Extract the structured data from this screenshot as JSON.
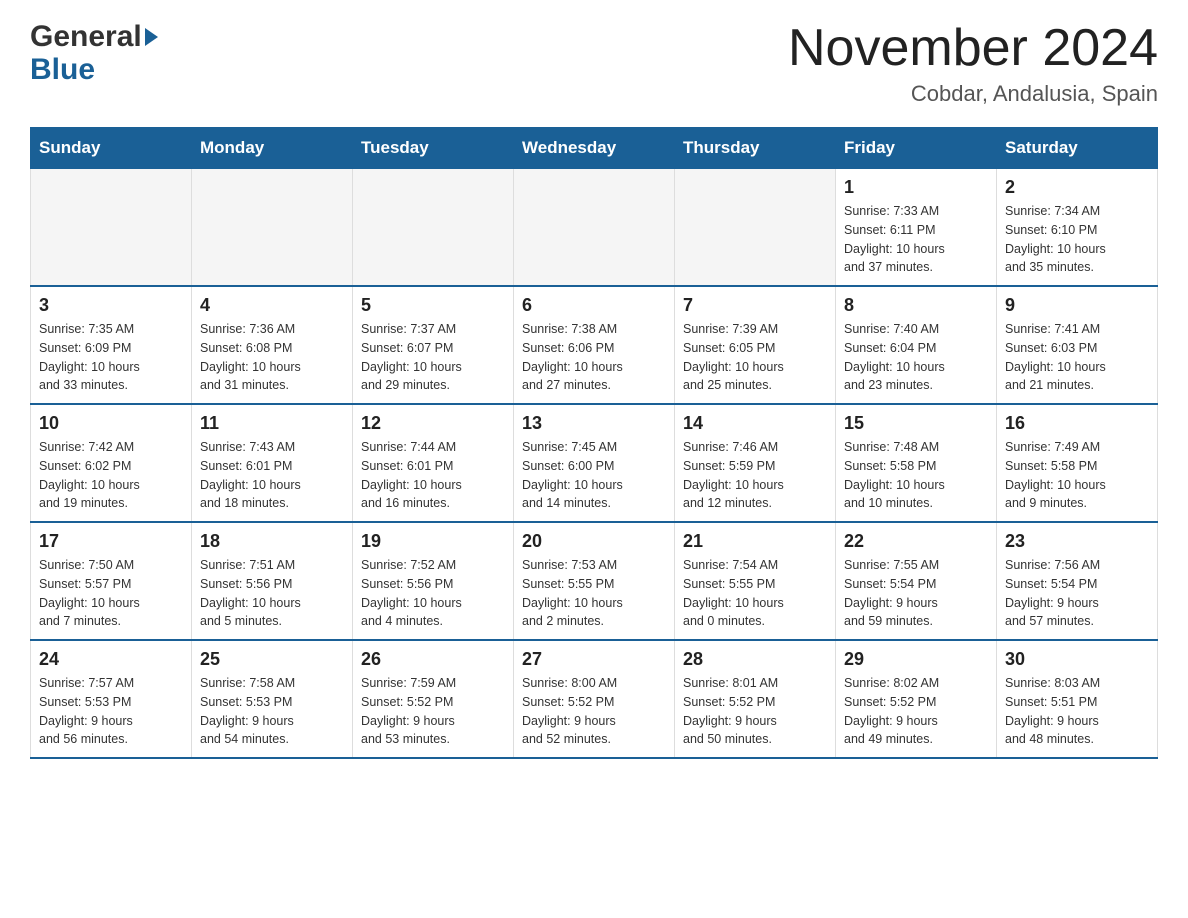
{
  "header": {
    "month_year": "November 2024",
    "location": "Cobdar, Andalusia, Spain",
    "logo_general": "General",
    "logo_blue": "Blue"
  },
  "weekdays": [
    "Sunday",
    "Monday",
    "Tuesday",
    "Wednesday",
    "Thursday",
    "Friday",
    "Saturday"
  ],
  "weeks": [
    [
      {
        "day": "",
        "info": ""
      },
      {
        "day": "",
        "info": ""
      },
      {
        "day": "",
        "info": ""
      },
      {
        "day": "",
        "info": ""
      },
      {
        "day": "",
        "info": ""
      },
      {
        "day": "1",
        "info": "Sunrise: 7:33 AM\nSunset: 6:11 PM\nDaylight: 10 hours\nand 37 minutes."
      },
      {
        "day": "2",
        "info": "Sunrise: 7:34 AM\nSunset: 6:10 PM\nDaylight: 10 hours\nand 35 minutes."
      }
    ],
    [
      {
        "day": "3",
        "info": "Sunrise: 7:35 AM\nSunset: 6:09 PM\nDaylight: 10 hours\nand 33 minutes."
      },
      {
        "day": "4",
        "info": "Sunrise: 7:36 AM\nSunset: 6:08 PM\nDaylight: 10 hours\nand 31 minutes."
      },
      {
        "day": "5",
        "info": "Sunrise: 7:37 AM\nSunset: 6:07 PM\nDaylight: 10 hours\nand 29 minutes."
      },
      {
        "day": "6",
        "info": "Sunrise: 7:38 AM\nSunset: 6:06 PM\nDaylight: 10 hours\nand 27 minutes."
      },
      {
        "day": "7",
        "info": "Sunrise: 7:39 AM\nSunset: 6:05 PM\nDaylight: 10 hours\nand 25 minutes."
      },
      {
        "day": "8",
        "info": "Sunrise: 7:40 AM\nSunset: 6:04 PM\nDaylight: 10 hours\nand 23 minutes."
      },
      {
        "day": "9",
        "info": "Sunrise: 7:41 AM\nSunset: 6:03 PM\nDaylight: 10 hours\nand 21 minutes."
      }
    ],
    [
      {
        "day": "10",
        "info": "Sunrise: 7:42 AM\nSunset: 6:02 PM\nDaylight: 10 hours\nand 19 minutes."
      },
      {
        "day": "11",
        "info": "Sunrise: 7:43 AM\nSunset: 6:01 PM\nDaylight: 10 hours\nand 18 minutes."
      },
      {
        "day": "12",
        "info": "Sunrise: 7:44 AM\nSunset: 6:01 PM\nDaylight: 10 hours\nand 16 minutes."
      },
      {
        "day": "13",
        "info": "Sunrise: 7:45 AM\nSunset: 6:00 PM\nDaylight: 10 hours\nand 14 minutes."
      },
      {
        "day": "14",
        "info": "Sunrise: 7:46 AM\nSunset: 5:59 PM\nDaylight: 10 hours\nand 12 minutes."
      },
      {
        "day": "15",
        "info": "Sunrise: 7:48 AM\nSunset: 5:58 PM\nDaylight: 10 hours\nand 10 minutes."
      },
      {
        "day": "16",
        "info": "Sunrise: 7:49 AM\nSunset: 5:58 PM\nDaylight: 10 hours\nand 9 minutes."
      }
    ],
    [
      {
        "day": "17",
        "info": "Sunrise: 7:50 AM\nSunset: 5:57 PM\nDaylight: 10 hours\nand 7 minutes."
      },
      {
        "day": "18",
        "info": "Sunrise: 7:51 AM\nSunset: 5:56 PM\nDaylight: 10 hours\nand 5 minutes."
      },
      {
        "day": "19",
        "info": "Sunrise: 7:52 AM\nSunset: 5:56 PM\nDaylight: 10 hours\nand 4 minutes."
      },
      {
        "day": "20",
        "info": "Sunrise: 7:53 AM\nSunset: 5:55 PM\nDaylight: 10 hours\nand 2 minutes."
      },
      {
        "day": "21",
        "info": "Sunrise: 7:54 AM\nSunset: 5:55 PM\nDaylight: 10 hours\nand 0 minutes."
      },
      {
        "day": "22",
        "info": "Sunrise: 7:55 AM\nSunset: 5:54 PM\nDaylight: 9 hours\nand 59 minutes."
      },
      {
        "day": "23",
        "info": "Sunrise: 7:56 AM\nSunset: 5:54 PM\nDaylight: 9 hours\nand 57 minutes."
      }
    ],
    [
      {
        "day": "24",
        "info": "Sunrise: 7:57 AM\nSunset: 5:53 PM\nDaylight: 9 hours\nand 56 minutes."
      },
      {
        "day": "25",
        "info": "Sunrise: 7:58 AM\nSunset: 5:53 PM\nDaylight: 9 hours\nand 54 minutes."
      },
      {
        "day": "26",
        "info": "Sunrise: 7:59 AM\nSunset: 5:52 PM\nDaylight: 9 hours\nand 53 minutes."
      },
      {
        "day": "27",
        "info": "Sunrise: 8:00 AM\nSunset: 5:52 PM\nDaylight: 9 hours\nand 52 minutes."
      },
      {
        "day": "28",
        "info": "Sunrise: 8:01 AM\nSunset: 5:52 PM\nDaylight: 9 hours\nand 50 minutes."
      },
      {
        "day": "29",
        "info": "Sunrise: 8:02 AM\nSunset: 5:52 PM\nDaylight: 9 hours\nand 49 minutes."
      },
      {
        "day": "30",
        "info": "Sunrise: 8:03 AM\nSunset: 5:51 PM\nDaylight: 9 hours\nand 48 minutes."
      }
    ]
  ]
}
